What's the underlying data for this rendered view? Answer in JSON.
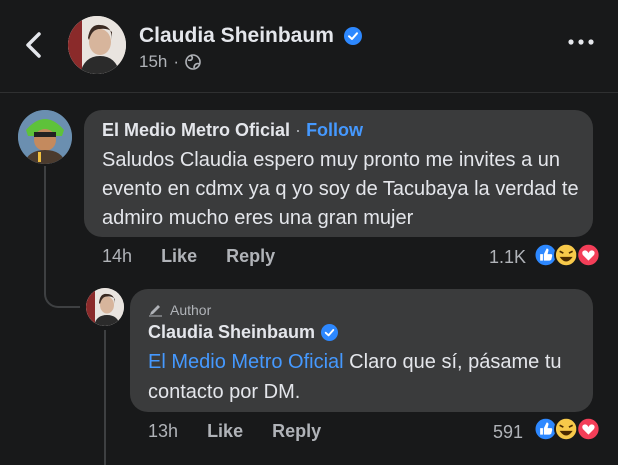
{
  "header": {
    "name": "Claudia Sheinbaum",
    "time": "15h",
    "dot": "·"
  },
  "comment1": {
    "author": "El Medio Metro Oficial",
    "separator": "·",
    "follow": "Follow",
    "text": "Saludos Claudia espero muy pronto me invites a un evento en cdmx ya q yo soy de Tacubaya la verdad te admiro mucho eres una gran mujer",
    "time": "14h",
    "like": "Like",
    "reply": "Reply",
    "reactions_count": "1.1K"
  },
  "comment2": {
    "badge": "Author",
    "author": "Claudia Sheinbaum",
    "mention": "El Medio Metro Oficial",
    "text": " Claro que sí, pásame tu contacto por DM.",
    "time": "13h",
    "like": "Like",
    "reply": "Reply",
    "reactions_count": "591"
  },
  "colors": {
    "background": "#18191a",
    "bubble": "#3a3b3c",
    "link": "#4599ff",
    "verified": "#2d88ff"
  }
}
